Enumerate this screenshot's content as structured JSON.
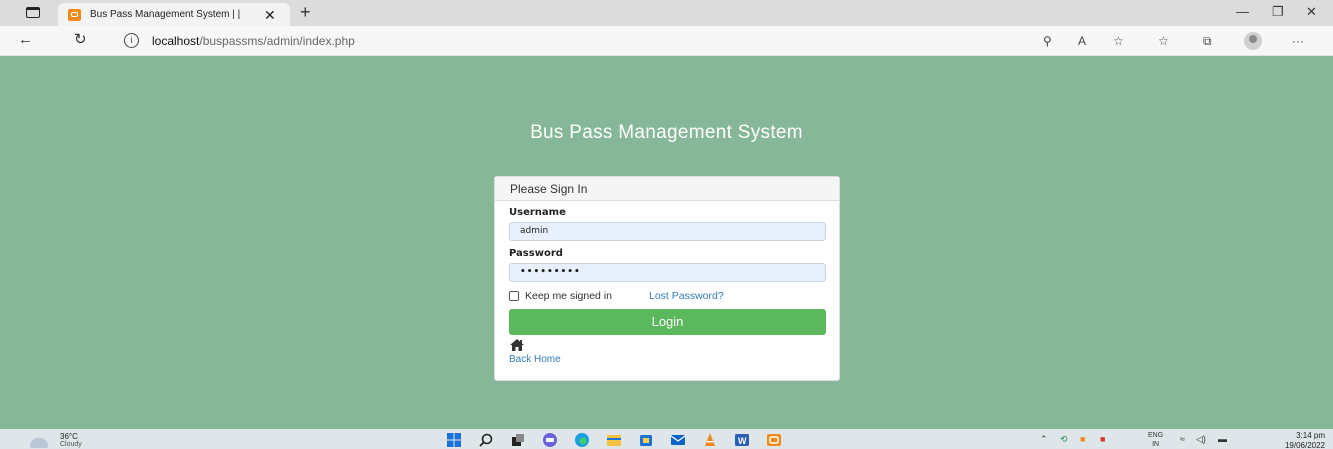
{
  "browser": {
    "tab_title": "Bus Pass Management System | |",
    "tab_close": "✕",
    "new_tab": "+",
    "url_host": "localhost",
    "url_path": "/buspassms/admin/index.php",
    "window_controls": {
      "minimize": "—",
      "maximize": "❐",
      "close": "✕"
    },
    "more": "···"
  },
  "page": {
    "heading": "Bus Pass Management System",
    "panel_title": "Please Sign In",
    "username_label": "Username",
    "username_value": "admin",
    "password_label": "Password",
    "password_value": "•••••••••",
    "remember_label": "Keep me signed in",
    "lost_password": "Lost Password?",
    "login_button": "Login",
    "back_home": "Back Home"
  },
  "taskbar": {
    "temperature": "36°C",
    "condition": "Cloudy",
    "language_top": "ENG",
    "language_bottom": "IN",
    "time": "3:14 pm",
    "date": "19/06/2022"
  },
  "colors": {
    "page_bg": "#86b798",
    "login_button": "#5cb85c",
    "link": "#337ab7",
    "input_bg": "#e8f0fe"
  },
  "icons": [
    "tab-switcher-icon",
    "favicon-icon",
    "back-icon",
    "refresh-icon",
    "info-icon",
    "read-aloud-icon",
    "favorites-icon",
    "collections-icon",
    "profile-icon",
    "home-icon",
    "windows-start-icon",
    "search-icon",
    "edge-icon",
    "folder-icon",
    "word-icon"
  ]
}
